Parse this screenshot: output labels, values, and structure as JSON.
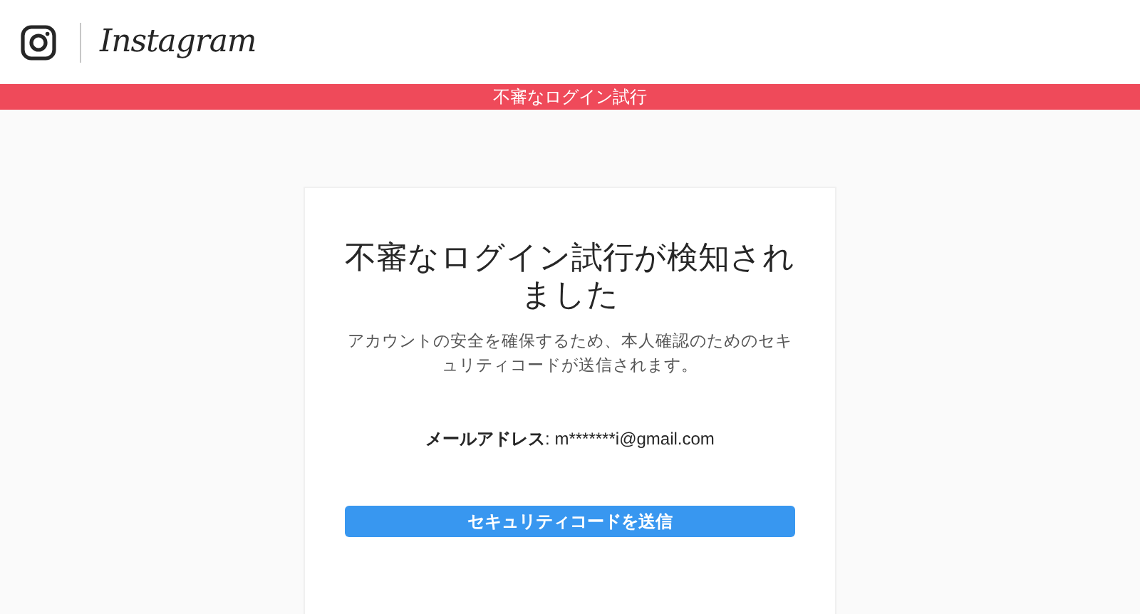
{
  "header": {
    "brand": "Instagram"
  },
  "banner": {
    "text": "不審なログイン試行"
  },
  "card": {
    "title": "不審なログイン試行が検知されました",
    "description": "アカウントの安全を確保するため、本人確認のためのセキュリティコードが送信されます。",
    "email_label": "メールアドレス",
    "email_value": ": m*******i@gmail.com",
    "button": "セキュリティコードを送信"
  }
}
